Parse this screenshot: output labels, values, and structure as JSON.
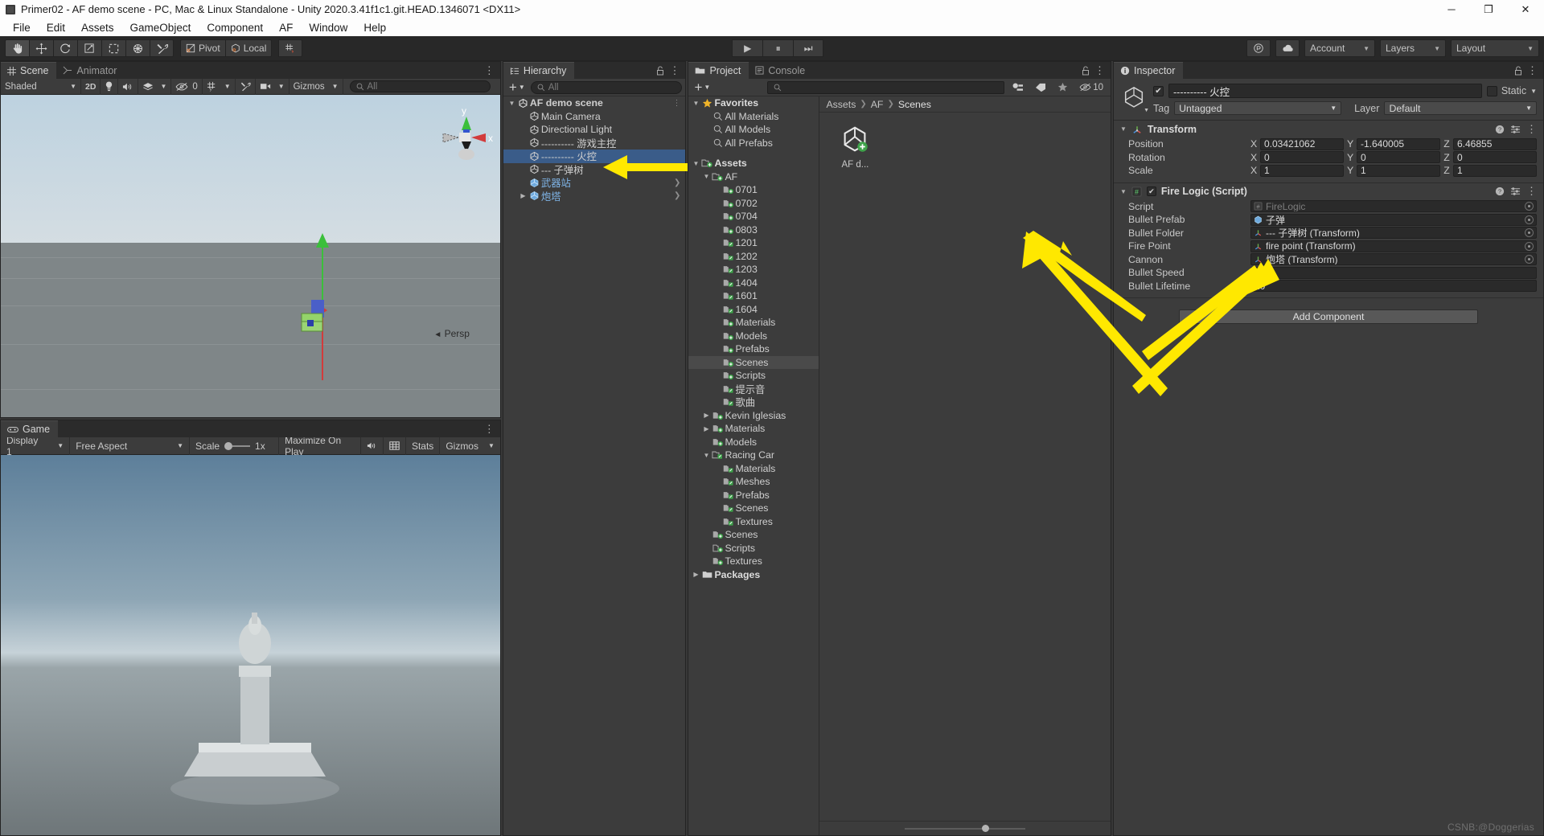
{
  "window": {
    "title": "Primer02 - AF demo scene - PC, Mac & Linux Standalone - Unity 2020.3.41f1c1.git.HEAD.1346071 <DX11>",
    "minimize": "─",
    "maximize": "❐",
    "close": "✕"
  },
  "menu": {
    "items": [
      "File",
      "Edit",
      "Assets",
      "GameObject",
      "Component",
      "AF",
      "Window",
      "Help"
    ]
  },
  "toolbar": {
    "tools": [
      {
        "name": "hand-tool",
        "glyph": "hand"
      },
      {
        "name": "move-tool",
        "glyph": "move"
      },
      {
        "name": "rotate-tool",
        "glyph": "rotate"
      },
      {
        "name": "scale-tool",
        "glyph": "scale"
      },
      {
        "name": "rect-tool",
        "glyph": "rect"
      },
      {
        "name": "transform-tool",
        "glyph": "transform"
      },
      {
        "name": "custom-tool",
        "glyph": "wrench"
      }
    ],
    "pivot_label": "Pivot",
    "local_label": "Local",
    "snap_label": "",
    "play": "▶",
    "pause": "⏸",
    "step": "⏭",
    "collab_label": "",
    "cloud_label": "",
    "account_label": "Account",
    "layers_label": "Layers",
    "layout_label": "Layout"
  },
  "scene_panel": {
    "tabs": [
      {
        "label": "Scene",
        "active": true,
        "icon": "grid-icon"
      },
      {
        "label": "Animator",
        "active": false,
        "icon": "animator-icon"
      }
    ],
    "controls": {
      "draw_mode": "Shaded",
      "mode_2d": "2D",
      "lighting_icon": "light-bulb-icon",
      "audio_icon": "speaker-icon",
      "fx_icon": "effects-icon",
      "hidden_count": "0",
      "grid_icon": "grid-visibility-icon",
      "tool_icon": "scene-tools-icon",
      "camera_icon": "scene-camera-icon",
      "gizmos_label": "Gizmos",
      "search_placeholder": "All"
    },
    "overlay": {
      "persp_label": "Persp",
      "axis_y": "y",
      "axis_x": "x"
    }
  },
  "game_panel": {
    "tab": "Game",
    "display": "Display 1",
    "aspect": "Free Aspect",
    "scale_label": "Scale",
    "scale_value": "1x",
    "maximize_label": "Maximize On Play",
    "mute_icon": "mute-audio-icon",
    "stats_label": "Stats",
    "gizmos_label": "Gizmos"
  },
  "hierarchy": {
    "tab": "Hierarchy",
    "add_label": "+",
    "search_placeholder": "All",
    "items": [
      {
        "label": "AF demo scene",
        "depth": 0,
        "icon": "unity-scene-icon",
        "twirl": "down",
        "selected": false,
        "bold": true,
        "kebab": true
      },
      {
        "label": "Main Camera",
        "depth": 1,
        "icon": "gameobject-icon",
        "twirl": "",
        "selected": false
      },
      {
        "label": "Directional Light",
        "depth": 1,
        "icon": "gameobject-icon",
        "twirl": "",
        "selected": false
      },
      {
        "label": "---------- 游戏主控",
        "depth": 1,
        "icon": "gameobject-icon",
        "twirl": "",
        "selected": false
      },
      {
        "label": "---------- 火控",
        "depth": 1,
        "icon": "gameobject-icon",
        "twirl": "",
        "selected": true
      },
      {
        "label": "--- 子弹树",
        "depth": 1,
        "icon": "gameobject-icon",
        "twirl": "",
        "selected": false
      },
      {
        "label": "武器站",
        "depth": 1,
        "icon": "prefab-icon",
        "twirl": "",
        "selected": false,
        "prefab": true,
        "chevron": true
      },
      {
        "label": "炮塔",
        "depth": 1,
        "icon": "prefab-icon",
        "twirl": "right",
        "selected": false,
        "prefab": true,
        "chevron": true
      }
    ]
  },
  "project": {
    "tabs": [
      {
        "label": "Project",
        "active": true,
        "icon": "folder-icon"
      },
      {
        "label": "Console",
        "active": false,
        "icon": "console-icon"
      }
    ],
    "add_label": "+",
    "search_placeholder": "",
    "hidden_count": "10",
    "breadcrumb": [
      "Assets",
      "AF",
      "Scenes"
    ],
    "tree": [
      {
        "label": "Favorites",
        "depth": 0,
        "twirl": "down",
        "icon": "star-icon",
        "bold": true
      },
      {
        "label": "All Materials",
        "depth": 1,
        "twirl": "",
        "icon": "search-icon"
      },
      {
        "label": "All Models",
        "depth": 1,
        "twirl": "",
        "icon": "search-icon"
      },
      {
        "label": "All Prefabs",
        "depth": 1,
        "twirl": "",
        "icon": "search-icon"
      },
      {
        "label": "",
        "depth": 0,
        "twirl": "",
        "icon": "spacer"
      },
      {
        "label": "Assets",
        "depth": 0,
        "twirl": "down",
        "icon": "folder-open-icon",
        "bold": true
      },
      {
        "label": "AF",
        "depth": 1,
        "twirl": "down",
        "icon": "folder-open-icon"
      },
      {
        "label": "0701",
        "depth": 2,
        "twirl": "",
        "icon": "folder-icon"
      },
      {
        "label": "0702",
        "depth": 2,
        "twirl": "",
        "icon": "folder-icon"
      },
      {
        "label": "0704",
        "depth": 2,
        "twirl": "",
        "icon": "folder-icon"
      },
      {
        "label": "0803",
        "depth": 2,
        "twirl": "",
        "icon": "folder-icon"
      },
      {
        "label": "1201",
        "depth": 2,
        "twirl": "",
        "icon": "folder-alt-icon"
      },
      {
        "label": "1202",
        "depth": 2,
        "twirl": "",
        "icon": "folder-alt-icon"
      },
      {
        "label": "1203",
        "depth": 2,
        "twirl": "",
        "icon": "folder-alt-icon"
      },
      {
        "label": "1404",
        "depth": 2,
        "twirl": "",
        "icon": "folder-alt-icon"
      },
      {
        "label": "1601",
        "depth": 2,
        "twirl": "",
        "icon": "folder-alt-icon"
      },
      {
        "label": "1604",
        "depth": 2,
        "twirl": "",
        "icon": "folder-alt-icon"
      },
      {
        "label": "Materials",
        "depth": 2,
        "twirl": "",
        "icon": "folder-icon"
      },
      {
        "label": "Models",
        "depth": 2,
        "twirl": "",
        "icon": "folder-icon"
      },
      {
        "label": "Prefabs",
        "depth": 2,
        "twirl": "",
        "icon": "folder-icon"
      },
      {
        "label": "Scenes",
        "depth": 2,
        "twirl": "",
        "icon": "folder-icon",
        "selected": true
      },
      {
        "label": "Scripts",
        "depth": 2,
        "twirl": "",
        "icon": "folder-icon"
      },
      {
        "label": "提示音",
        "depth": 2,
        "twirl": "",
        "icon": "folder-alt-icon"
      },
      {
        "label": "歌曲",
        "depth": 2,
        "twirl": "",
        "icon": "folder-alt-icon"
      },
      {
        "label": "Kevin Iglesias",
        "depth": 1,
        "twirl": "right",
        "icon": "folder-icon"
      },
      {
        "label": "Materials",
        "depth": 1,
        "twirl": "right",
        "icon": "folder-icon"
      },
      {
        "label": "Models",
        "depth": 1,
        "twirl": "",
        "icon": "folder-icon"
      },
      {
        "label": "Racing Car",
        "depth": 1,
        "twirl": "down",
        "icon": "folder-open-alt-icon"
      },
      {
        "label": "Materials",
        "depth": 2,
        "twirl": "",
        "icon": "folder-alt-icon"
      },
      {
        "label": "Meshes",
        "depth": 2,
        "twirl": "",
        "icon": "folder-alt-icon"
      },
      {
        "label": "Prefabs",
        "depth": 2,
        "twirl": "",
        "icon": "folder-alt-icon"
      },
      {
        "label": "Scenes",
        "depth": 2,
        "twirl": "",
        "icon": "folder-alt-icon"
      },
      {
        "label": "Textures",
        "depth": 2,
        "twirl": "",
        "icon": "folder-alt-icon"
      },
      {
        "label": "Scenes",
        "depth": 1,
        "twirl": "",
        "icon": "folder-icon"
      },
      {
        "label": "Scripts",
        "depth": 1,
        "twirl": "",
        "icon": "folder-outline-icon"
      },
      {
        "label": "Textures",
        "depth": 1,
        "twirl": "",
        "icon": "folder-icon"
      },
      {
        "label": "Packages",
        "depth": 0,
        "twirl": "right",
        "icon": "folder-plain-icon",
        "bold": true
      }
    ],
    "assets": [
      {
        "label": "AF d...",
        "icon": "unity-scene-asset-icon"
      }
    ]
  },
  "inspector": {
    "tab": "Inspector",
    "lock_icon": "lock-icon",
    "object": {
      "enabled": true,
      "name": "---------- 火控",
      "static_label": "Static",
      "tag_label": "Tag",
      "tag_value": "Untagged",
      "layer_label": "Layer",
      "layer_value": "Default"
    },
    "transform": {
      "title": "Transform",
      "rows": [
        {
          "label": "Position",
          "x": "0.03421062",
          "y": "-1.640005",
          "z": "6.46855"
        },
        {
          "label": "Rotation",
          "x": "0",
          "y": "0",
          "z": "0"
        },
        {
          "label": "Scale",
          "x": "1",
          "y": "1",
          "z": "1"
        }
      ]
    },
    "fire_logic": {
      "title": "Fire Logic (Script)",
      "enabled": true,
      "fields": [
        {
          "label": "Script",
          "value": "FireLogic",
          "type": "object",
          "icon": "script-icon",
          "disabled": true
        },
        {
          "label": "Bullet Prefab",
          "value": "子弹",
          "type": "object",
          "icon": "prefab-icon"
        },
        {
          "label": "Bullet Folder",
          "value": "--- 子弹树 (Transform)",
          "type": "object",
          "icon": "transform-icon"
        },
        {
          "label": "Fire Point",
          "value": "fire point (Transform)",
          "type": "object",
          "icon": "transform-icon"
        },
        {
          "label": "Cannon",
          "value": "炮塔 (Transform)",
          "type": "object",
          "icon": "transform-icon"
        },
        {
          "label": "Bullet Speed",
          "value": "0.5",
          "type": "number"
        },
        {
          "label": "Bullet Lifetime",
          "value": "10",
          "type": "number"
        }
      ]
    },
    "add_component_label": "Add Component"
  },
  "watermark": "CSNB:@Doggerias",
  "colors": {
    "accent": "#3a5c89",
    "arrow": "#ffe500",
    "prefab_blue": "#7fb5e8",
    "folder_green": "#3ea34a"
  }
}
